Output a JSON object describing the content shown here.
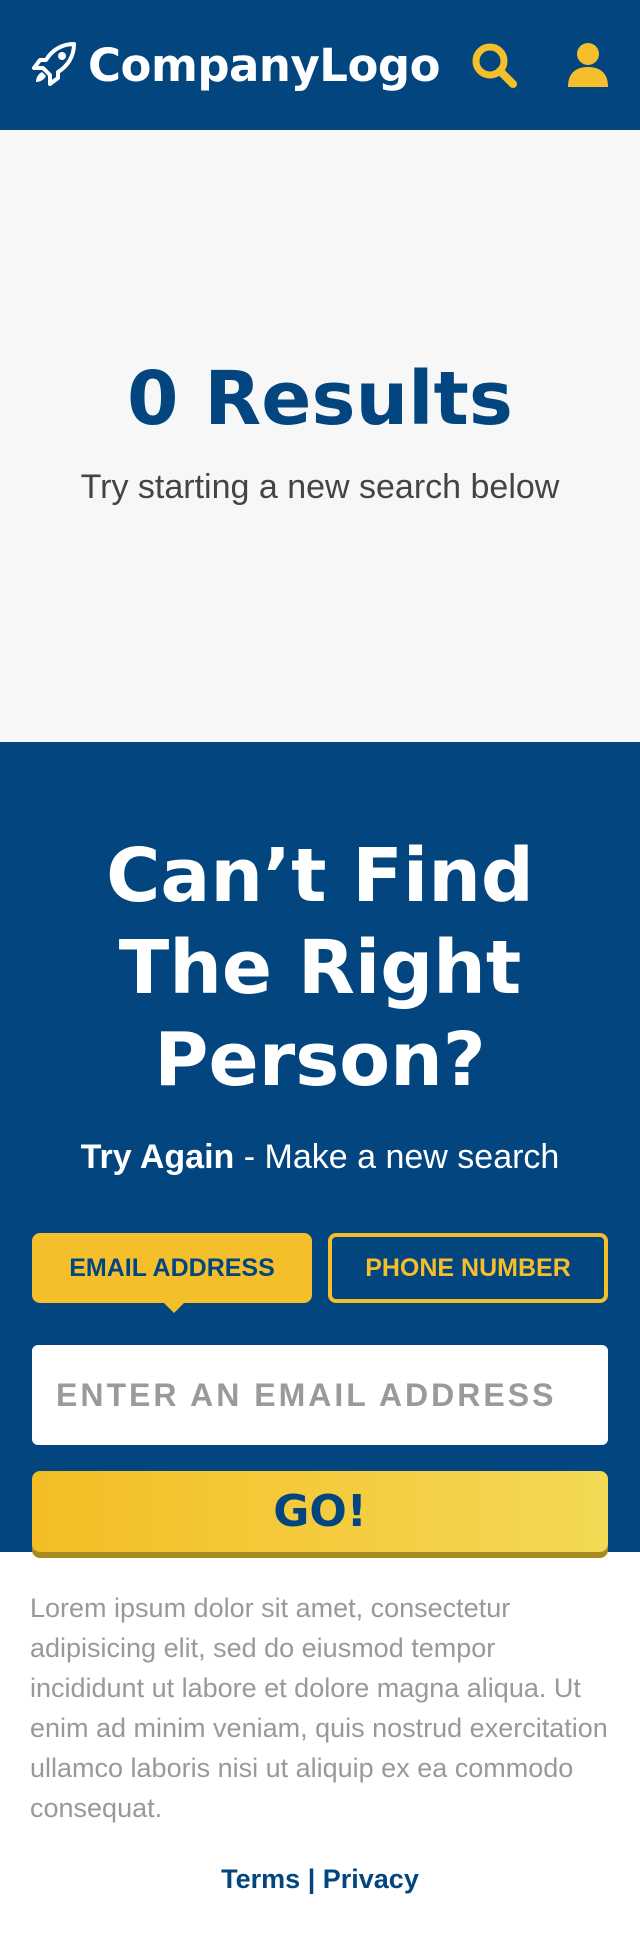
{
  "header": {
    "logo_text": "CompanyLogo",
    "logo_icon": "rocket-icon",
    "search_icon": "search-icon",
    "user_icon": "user-icon",
    "background_color": "#03467f",
    "accent_color": "#f4bf2a"
  },
  "results": {
    "title": "0 Results",
    "subtitle": "Try starting a new search below"
  },
  "search": {
    "title": "Can’t Find The Right Person?",
    "subtitle_bold": "Try Again",
    "subtitle_rest": " - Make a new search",
    "tabs": [
      {
        "label": "EMAIL ADDRESS",
        "active": true
      },
      {
        "label": "PHONE NUMBER",
        "active": false
      }
    ],
    "input_placeholder": "ENTER AN EMAIL ADDRESS",
    "input_value": "",
    "go_label": "GO!"
  },
  "footer": {
    "text": "Lorem ipsum dolor sit amet, consectetur adipisicing elit, sed do eiusmod tempor incididunt ut labore et dolore magna aliqua. Ut enim ad minim veniam, quis nostrud exercitation ullamco laboris nisi ut aliquip ex ea commodo consequat.",
    "terms_label": "Terms",
    "separator": " | ",
    "privacy_label": "Privacy"
  }
}
